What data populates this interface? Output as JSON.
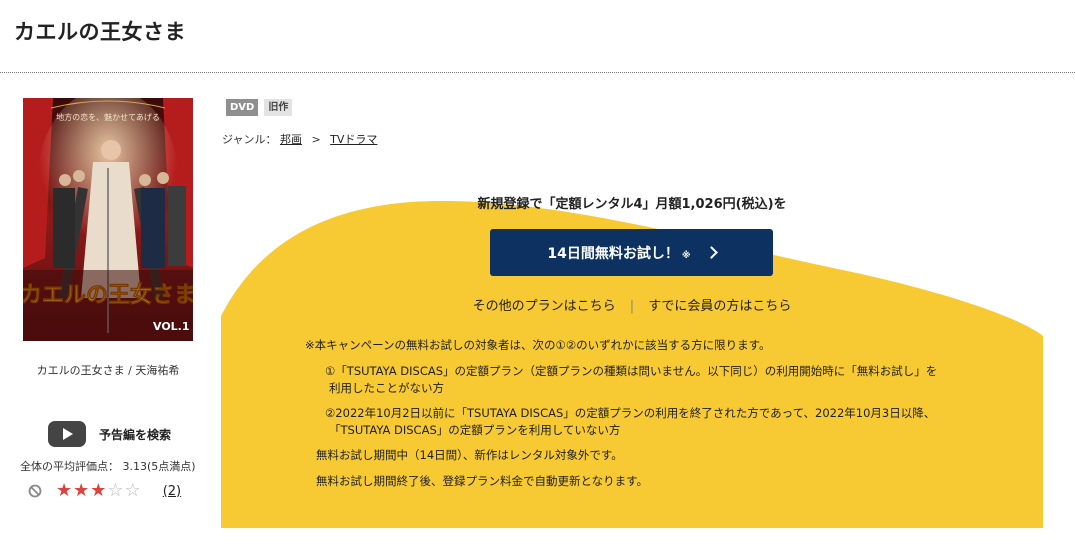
{
  "page": {
    "title": "カエルの王女さま"
  },
  "product": {
    "cover_title": "カエルの王女さま",
    "cover_vol": "VOL.1",
    "cover_tagline": "地方の恋を、魅かせてあげる",
    "caption": "カエルの王女さま / 天海祐希",
    "trailer_label": "予告編を検索",
    "average_label": "全体の平均評価点： 3.13(5点満点)",
    "rating": 3,
    "rating_max": 5,
    "review_count": "(2)",
    "accent_star": "#d9443f"
  },
  "badges": {
    "dvd": "DVD",
    "old": "旧作"
  },
  "genre": {
    "label": "ジャンル：",
    "crumbs": [
      "邦画",
      "TVドラマ"
    ],
    "separator": ">"
  },
  "campaign": {
    "headline": "新規登録で「定額レンタル4」月額1,026円(税込)を",
    "cta_label": "14日間無料お試し！",
    "cta_note": "※",
    "other_plans": "その他のプランはこちら",
    "divider": "|",
    "existing_member": "すでに会員の方はこちら",
    "colors": {
      "yellow": "#f7c933",
      "navy": "#0d3262"
    },
    "notes": {
      "head": "※本キャンペーンの無料お試しの対象者は、次の①②のいずれかに該当する方に限ります。",
      "item1_line1": "①「TSUTAYA DISCAS」の定額プラン（定額プランの種類は問いません。以下同じ）の利用開始時に「無料お試し」を",
      "item1_line2": "利用したことがない方",
      "item2_line1": "②2022年10月2日以前に「TSUTAYA DISCAS」の定額プランの利用を終了された方であって、2022年10月3日以降、",
      "item2_line2": "「TSUTAYA DISCAS」の定額プランを利用していない方",
      "plain1": "無料お試し期間中（14日間）、新作はレンタル対象外です。",
      "plain2": "無料お試し期間終了後、登録プラン料金で自動更新となります。"
    }
  }
}
